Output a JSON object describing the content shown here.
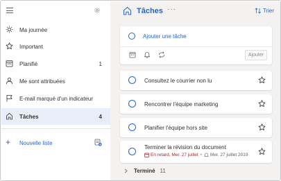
{
  "sidebar": {
    "items": [
      {
        "label": "Ma journée",
        "count": "",
        "icon": "sun-icon"
      },
      {
        "label": "Important",
        "count": "",
        "icon": "star-icon"
      },
      {
        "label": "Planifié",
        "count": "1",
        "icon": "calendar-icon"
      },
      {
        "label": "Me sont attribuées",
        "count": "",
        "icon": "person-icon"
      },
      {
        "label": "E-mail marqué d'un indicateur",
        "count": "",
        "icon": "flag-icon"
      },
      {
        "label": "Tâches",
        "count": "4",
        "icon": "home-icon"
      }
    ],
    "new_list_label": "Nouvelle liste"
  },
  "header": {
    "title": "Tâches",
    "more": "···",
    "sort_label": "Trier"
  },
  "add_task": {
    "placeholder": "Ajouter une tâche",
    "add_button": "Ajouter"
  },
  "tasks": [
    {
      "title": "Consultez le courrier non lu"
    },
    {
      "title": "Rencontrer l'équipe marketing"
    },
    {
      "title": "Planifier l'équipe hors site"
    },
    {
      "title": "Terminer la révision du document",
      "due": "En retard, Mer. 27 juillet",
      "separator": "•",
      "reminder": "Mer. 27 juillet 2019"
    }
  ],
  "completed": {
    "label": "Terminé",
    "count": "11"
  },
  "colors": {
    "accent": "#2564cf",
    "overdue": "#a4262c",
    "active_item_bg": "#e8eef7",
    "main_bg": "#f3f2f1"
  }
}
